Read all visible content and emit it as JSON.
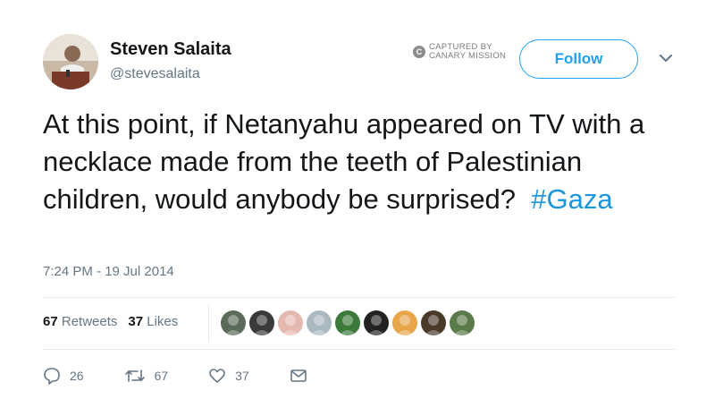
{
  "user": {
    "name": "Steven Salaita",
    "handle": "@stevesalaita"
  },
  "watermark": {
    "line1": "CAPTURED BY",
    "line2": "CANARY MISSION",
    "glyph": "C"
  },
  "follow_label": "Follow",
  "tweet": {
    "text": "At this point, if Netanyahu appeared on TV with a necklace made from the teeth of Palestinian children, would anybody be surprised?",
    "hashtag": "#Gaza",
    "timestamp": "7:24 PM - 19 Jul 2014"
  },
  "stats": {
    "retweets_count": "67",
    "retweets_label": "Retweets",
    "likes_count": "37",
    "likes_label": "Likes"
  },
  "likers": [
    {
      "icon": "liker-avatar-1",
      "color": "#5b6b5a"
    },
    {
      "icon": "liker-avatar-2",
      "color": "#3a3a3a"
    },
    {
      "icon": "liker-avatar-3",
      "color": "#e5b9b0"
    },
    {
      "icon": "liker-avatar-4",
      "color": "#aab8c2"
    },
    {
      "icon": "liker-avatar-5",
      "color": "#3c7a3a"
    },
    {
      "icon": "liker-avatar-6",
      "color": "#222222"
    },
    {
      "icon": "liker-avatar-7",
      "color": "#e8a54a"
    },
    {
      "icon": "liker-avatar-8",
      "color": "#4a3a2a"
    },
    {
      "icon": "liker-avatar-9",
      "color": "#5a7a4a"
    }
  ],
  "actions": {
    "reply_count": "26",
    "retweet_count": "67",
    "like_count": "37"
  },
  "colors": {
    "accent": "#1da1f2",
    "hashtag": "#1b95e0",
    "secondary": "#657786"
  }
}
